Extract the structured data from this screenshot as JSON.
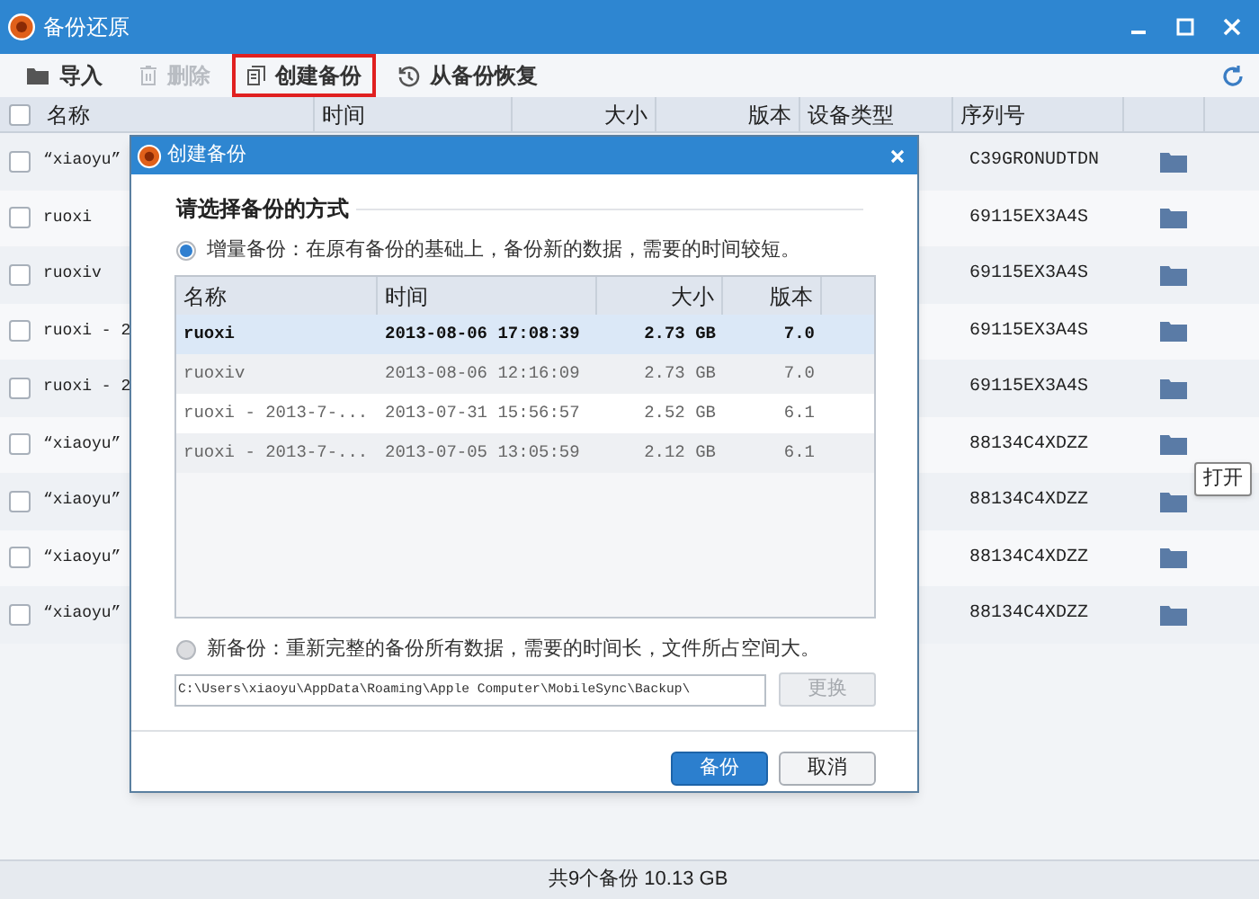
{
  "window": {
    "title": "备份还原"
  },
  "toolbar": [
    {
      "label": "导入",
      "kind": "import",
      "disabled": false,
      "highlighted": false
    },
    {
      "label": "删除",
      "kind": "delete",
      "disabled": true,
      "highlighted": false
    },
    {
      "label": "创建备份",
      "kind": "create",
      "disabled": false,
      "highlighted": true
    },
    {
      "label": "从备份恢复",
      "kind": "restore",
      "disabled": false,
      "highlighted": false
    }
  ],
  "table": {
    "all_checked": false,
    "columns": [
      "名称",
      "时间",
      "大小",
      "版本",
      "设备类型",
      "序列号"
    ],
    "rows": [
      {
        "name": "“xiaoyu”",
        "serial": "C39GRONUDTDN",
        "checked": false
      },
      {
        "name": "ruoxi",
        "serial": "69115EX3A4S",
        "checked": false
      },
      {
        "name": "ruoxiv",
        "serial": "69115EX3A4S",
        "checked": false
      },
      {
        "name": "ruoxi - 2",
        "serial": "69115EX3A4S",
        "checked": false
      },
      {
        "name": "ruoxi - 2",
        "serial": "69115EX3A4S",
        "checked": false
      },
      {
        "name": "“xiaoyu”",
        "serial": "88134C4XDZZ",
        "checked": false
      },
      {
        "name": "“xiaoyu”",
        "serial": "88134C4XDZZ",
        "checked": false
      },
      {
        "name": "“xiaoyu”",
        "serial": "88134C4XDZZ",
        "checked": false
      },
      {
        "name": "“xiaoyu”",
        "serial": "88134C4XDZZ",
        "checked": false
      }
    ]
  },
  "tooltip": "打开",
  "status_bar": "共9个备份 10.13 GB",
  "dialog": {
    "title": "创建备份",
    "heading": "请选择备份的方式",
    "options": [
      {
        "label": "增量备份：在原有备份的基础上，备份新的数据，需要的时间较短。",
        "selected": true
      },
      {
        "label": "新备份：重新完整的备份所有数据，需要的时间长，文件所占空间大。",
        "selected": false
      }
    ],
    "columns": [
      "名称",
      "时间",
      "大小",
      "版本"
    ],
    "backups": [
      {
        "name": "ruoxi",
        "time": "2013-08-06 17:08:39",
        "size": "2.73 GB",
        "version": "7.0",
        "selected": true
      },
      {
        "name": "ruoxiv",
        "time": "2013-08-06 12:16:09",
        "size": "2.73 GB",
        "version": "7.0",
        "selected": false
      },
      {
        "name": "ruoxi - 2013-7-...",
        "time": "2013-07-31 15:56:57",
        "size": "2.52 GB",
        "version": "6.1",
        "selected": false
      },
      {
        "name": "ruoxi - 2013-7-...",
        "time": "2013-07-05 13:05:59",
        "size": "2.12 GB",
        "version": "6.1",
        "selected": false
      }
    ],
    "path": "C:\\Users\\xiaoyu\\AppData\\Roaming\\Apple Computer\\MobileSync\\Backup\\",
    "change_button": {
      "label": "更换",
      "disabled": true
    },
    "buttons": [
      "备份",
      "取消"
    ]
  }
}
